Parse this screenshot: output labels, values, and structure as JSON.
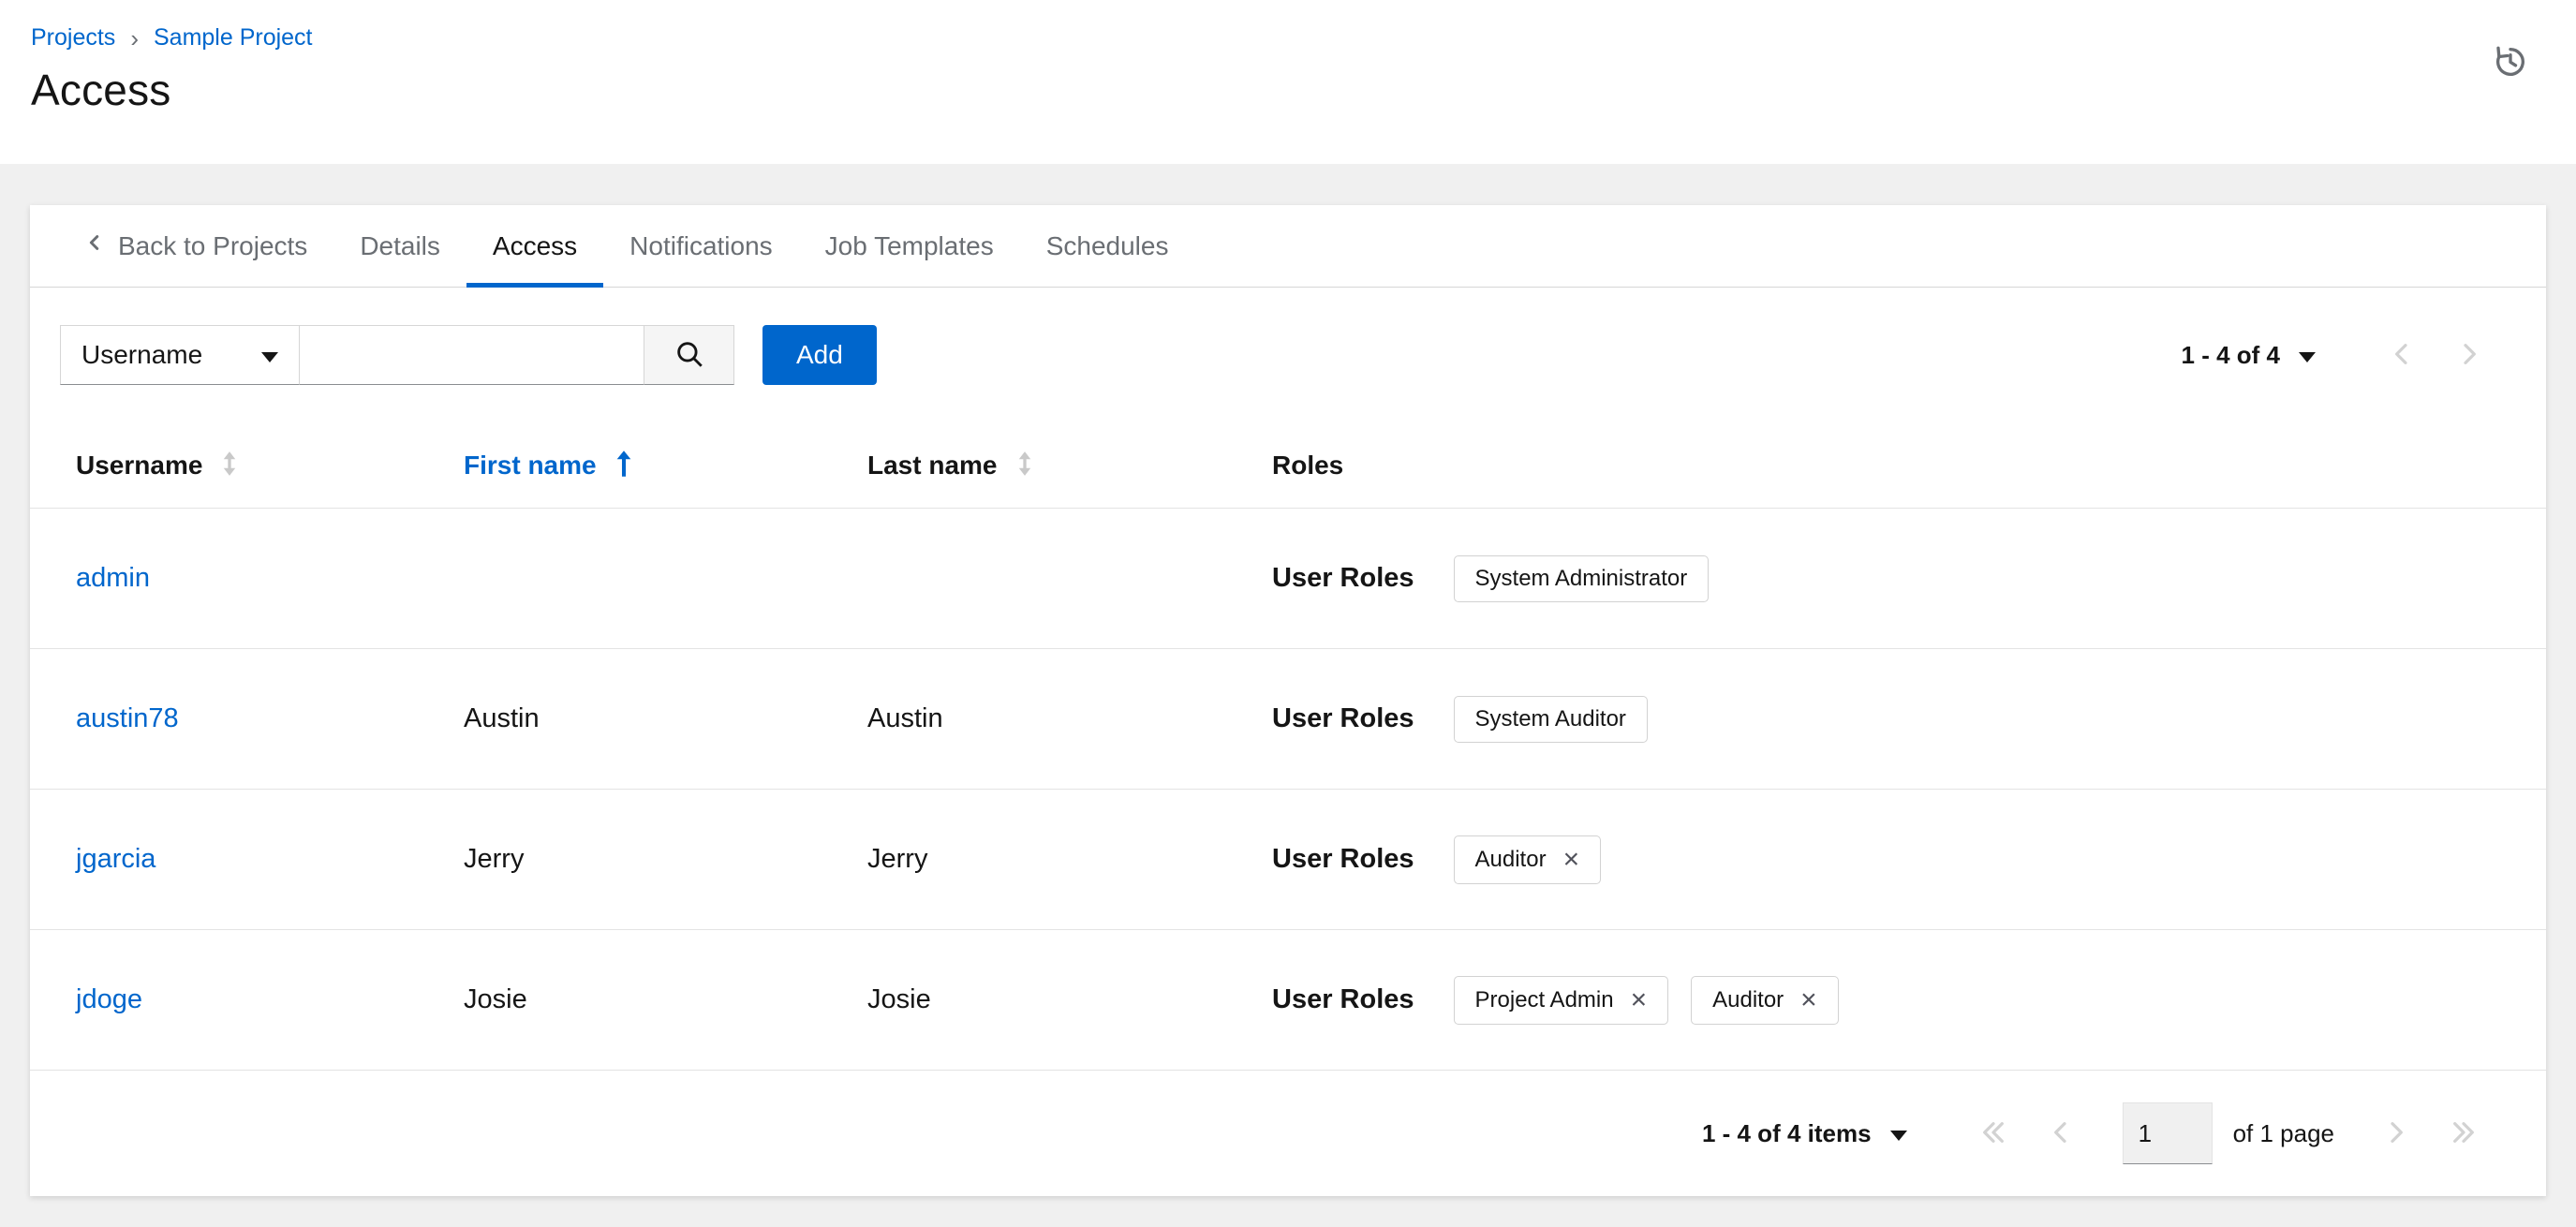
{
  "colors": {
    "accent": "#0066cc",
    "link": "#0066cc",
    "text": "#151515",
    "muted_text": "#6a6e73",
    "page_background": "#f0f0f0",
    "border": "#d2d2d2",
    "disabled_arrow": "#d2d2d2"
  },
  "icons": {
    "history": "clock-with-counterclockwise-arrow",
    "search": "magnifier",
    "chevron_down": "solid-caret-down",
    "back_chevron": "angle-left",
    "sort_unsorted": "vertical-double-arrow",
    "sort_ascending": "long-arrow-up",
    "remove": "×",
    "breadcrumb_sep": "›"
  },
  "breadcrumb": {
    "items": [
      "Projects",
      "Sample Project"
    ]
  },
  "page": {
    "title": "Access"
  },
  "tabs": [
    {
      "label": "Back to Projects"
    },
    {
      "label": "Details"
    },
    {
      "label": "Access",
      "active": true
    },
    {
      "label": "Notifications"
    },
    {
      "label": "Job Templates"
    },
    {
      "label": "Schedules"
    }
  ],
  "toolbar": {
    "filter_dropdown": {
      "value": "Username"
    },
    "search_input": {
      "value": "",
      "placeholder": ""
    },
    "add_button": "Add",
    "pagination": {
      "summary": "1 - 4 of 4"
    }
  },
  "table": {
    "columns": [
      {
        "label": "Username",
        "sortable": true,
        "sorted": false
      },
      {
        "label": "First name",
        "sortable": true,
        "sorted": "ascending"
      },
      {
        "label": "Last name",
        "sortable": true,
        "sorted": false
      },
      {
        "label": "Roles",
        "sortable": false
      }
    ],
    "rows": [
      {
        "username": "admin",
        "first_name": "",
        "last_name": "",
        "roles_label": "User Roles",
        "chips": [
          {
            "label": "System Administrator",
            "removable": false
          }
        ]
      },
      {
        "username": "austin78",
        "first_name": "Austin",
        "last_name": "Austin",
        "roles_label": "User Roles",
        "chips": [
          {
            "label": "System Auditor",
            "removable": false
          }
        ]
      },
      {
        "username": "jgarcia",
        "first_name": "Jerry",
        "last_name": "Jerry",
        "roles_label": "User Roles",
        "chips": [
          {
            "label": "Auditor",
            "removable": true
          }
        ]
      },
      {
        "username": "jdoge",
        "first_name": "Josie",
        "last_name": "Josie",
        "roles_label": "User Roles",
        "chips": [
          {
            "label": "Project Admin",
            "removable": true
          },
          {
            "label": "Auditor",
            "removable": true
          }
        ]
      }
    ]
  },
  "footer": {
    "summary": "1 - 4 of 4 items",
    "page_value": "1",
    "page_label": "of 1 page"
  }
}
